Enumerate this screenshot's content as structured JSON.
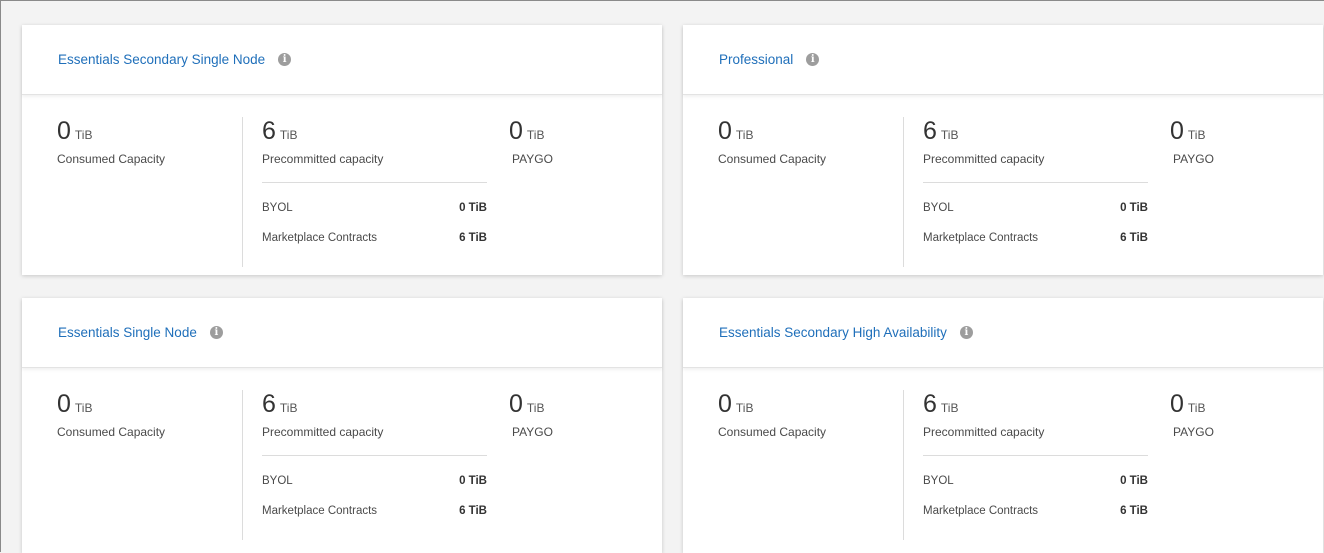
{
  "cards": [
    {
      "title": "Essentials Secondary Single Node",
      "consumed": {
        "value": "0",
        "unit": "TiB",
        "label": "Consumed Capacity"
      },
      "precommitted": {
        "value": "6",
        "unit": "TiB",
        "label": "Precommitted capacity"
      },
      "paygo": {
        "value": "0",
        "unit": "TiB",
        "label": "PAYGO"
      },
      "byol": {
        "label": "BYOL",
        "value": "0 TiB"
      },
      "marketplace": {
        "label": "Marketplace Contracts",
        "value": "6 TiB"
      }
    },
    {
      "title": "Professional",
      "consumed": {
        "value": "0",
        "unit": "TiB",
        "label": "Consumed Capacity"
      },
      "precommitted": {
        "value": "6",
        "unit": "TiB",
        "label": "Precommitted capacity"
      },
      "paygo": {
        "value": "0",
        "unit": "TiB",
        "label": "PAYGO"
      },
      "byol": {
        "label": "BYOL",
        "value": "0 TiB"
      },
      "marketplace": {
        "label": "Marketplace Contracts",
        "value": "6 TiB"
      }
    },
    {
      "title": "Essentials Single Node",
      "consumed": {
        "value": "0",
        "unit": "TiB",
        "label": "Consumed Capacity"
      },
      "precommitted": {
        "value": "6",
        "unit": "TiB",
        "label": "Precommitted capacity"
      },
      "paygo": {
        "value": "0",
        "unit": "TiB",
        "label": "PAYGO"
      },
      "byol": {
        "label": "BYOL",
        "value": "0 TiB"
      },
      "marketplace": {
        "label": "Marketplace Contracts",
        "value": "6 TiB"
      }
    },
    {
      "title": "Essentials Secondary High Availability",
      "consumed": {
        "value": "0",
        "unit": "TiB",
        "label": "Consumed Capacity"
      },
      "precommitted": {
        "value": "6",
        "unit": "TiB",
        "label": "Precommitted capacity"
      },
      "paygo": {
        "value": "0",
        "unit": "TiB",
        "label": "PAYGO"
      },
      "byol": {
        "label": "BYOL",
        "value": "0 TiB"
      },
      "marketplace": {
        "label": "Marketplace Contracts",
        "value": "6 TiB"
      }
    }
  ],
  "info_icon_glyph": "i",
  "colors": {
    "title": "#1f6fba",
    "info_icon": "#9d9d9d"
  }
}
